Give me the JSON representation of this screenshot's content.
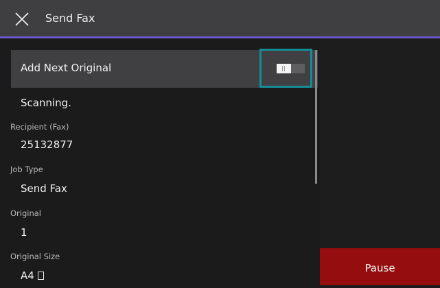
{
  "header": {
    "title": "Send Fax",
    "close_icon": "close-icon"
  },
  "add_next_original": {
    "label": "Add Next Original",
    "toggle_state": "on"
  },
  "status": "Scanning.",
  "fields": {
    "recipient": {
      "label": "Recipient (Fax)",
      "value": "25132877"
    },
    "job_type": {
      "label": "Job Type",
      "value": "Send Fax"
    },
    "original": {
      "label": "Original",
      "value": "1"
    },
    "original_size": {
      "label": "Original Size",
      "value": "A4",
      "icon": "portrait-paper-icon"
    }
  },
  "actions": {
    "pause_label": "Pause"
  },
  "colors": {
    "header_bg": "#3f3f42",
    "header_accent": "#6a57c9",
    "toggle_highlight": "#158d96",
    "pause_bg": "#960d0d"
  }
}
